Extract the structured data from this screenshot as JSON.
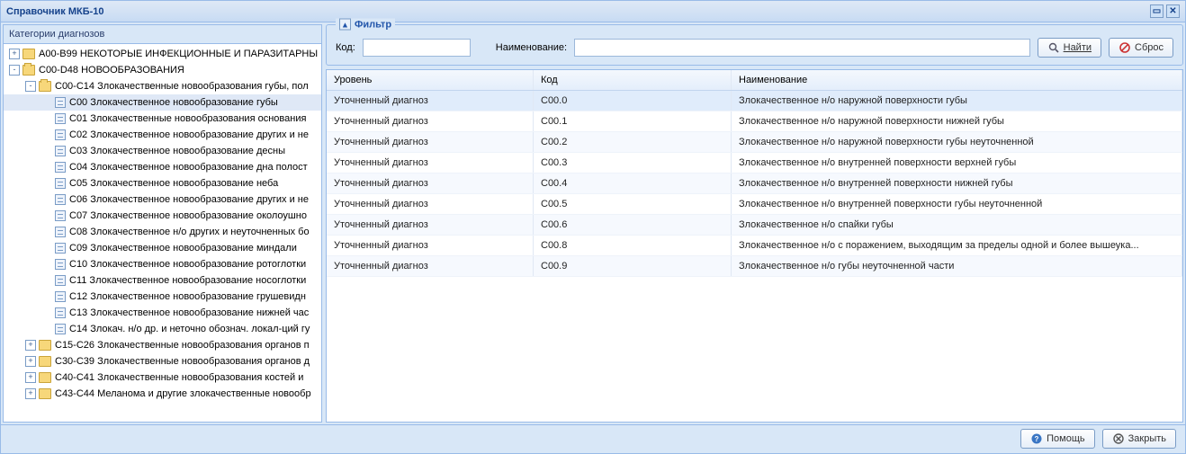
{
  "window": {
    "title": "Справочник МКБ-10"
  },
  "left_panel": {
    "title": "Категории диагнозов"
  },
  "tree": [
    {
      "indent": 0,
      "toggle": "+",
      "icon": "folder",
      "label": "A00-B99 НЕКОТОРЫЕ ИНФЕКЦИОННЫЕ И ПАРАЗИТАРНЫ",
      "name": "tree-a00-b99"
    },
    {
      "indent": 0,
      "toggle": "-",
      "icon": "folder-open",
      "label": "C00-D48 НОВООБРАЗОВАНИЯ",
      "name": "tree-c00-d48"
    },
    {
      "indent": 1,
      "toggle": "-",
      "icon": "folder-open",
      "label": "C00-C14 Злокачественные новообразования губы, пол",
      "name": "tree-c00-c14"
    },
    {
      "indent": 2,
      "toggle": "",
      "icon": "leaf",
      "label": "C00 Злокачественное новообразование губы",
      "selected": true,
      "name": "tree-c00"
    },
    {
      "indent": 2,
      "toggle": "",
      "icon": "leaf",
      "label": "C01 Злокачественные новообразования основания",
      "name": "tree-c01"
    },
    {
      "indent": 2,
      "toggle": "",
      "icon": "leaf",
      "label": "C02 Злокачественное новообразование других и не",
      "name": "tree-c02"
    },
    {
      "indent": 2,
      "toggle": "",
      "icon": "leaf",
      "label": "C03 Злокачественное новообразование десны",
      "name": "tree-c03"
    },
    {
      "indent": 2,
      "toggle": "",
      "icon": "leaf",
      "label": "C04 Злокачественное новообразование дна полост",
      "name": "tree-c04"
    },
    {
      "indent": 2,
      "toggle": "",
      "icon": "leaf",
      "label": "C05 Злокачественное новообразование неба",
      "name": "tree-c05"
    },
    {
      "indent": 2,
      "toggle": "",
      "icon": "leaf",
      "label": "C06 Злокачественное новообразование других и не",
      "name": "tree-c06"
    },
    {
      "indent": 2,
      "toggle": "",
      "icon": "leaf",
      "label": "C07 Злокачественное новообразование околоушно",
      "name": "tree-c07"
    },
    {
      "indent": 2,
      "toggle": "",
      "icon": "leaf",
      "label": "C08 Злокачественное н/о других и неуточненных бо",
      "name": "tree-c08"
    },
    {
      "indent": 2,
      "toggle": "",
      "icon": "leaf",
      "label": "C09 Злокачественное новообразование миндали",
      "name": "tree-c09"
    },
    {
      "indent": 2,
      "toggle": "",
      "icon": "leaf",
      "label": "C10 Злокачественное новообразование ротоглотки",
      "name": "tree-c10"
    },
    {
      "indent": 2,
      "toggle": "",
      "icon": "leaf",
      "label": "C11 Злокачественное новообразование носоглотки",
      "name": "tree-c11"
    },
    {
      "indent": 2,
      "toggle": "",
      "icon": "leaf",
      "label": "C12 Злокачественное новообразование грушевидн",
      "name": "tree-c12"
    },
    {
      "indent": 2,
      "toggle": "",
      "icon": "leaf",
      "label": "C13 Злокачественное новообразование нижней час",
      "name": "tree-c13"
    },
    {
      "indent": 2,
      "toggle": "",
      "icon": "leaf",
      "label": "C14 Злокач. н/о др. и неточно обознач. локал-ций гу",
      "name": "tree-c14"
    },
    {
      "indent": 1,
      "toggle": "+",
      "icon": "folder",
      "label": "C15-C26 Злокачественные новообразования органов п",
      "name": "tree-c15-c26"
    },
    {
      "indent": 1,
      "toggle": "+",
      "icon": "folder",
      "label": "C30-C39 Злокачественные новообразования органов д",
      "name": "tree-c30-c39"
    },
    {
      "indent": 1,
      "toggle": "+",
      "icon": "folder",
      "label": "C40-C41 Злокачественные новообразования костей и",
      "name": "tree-c40-c41"
    },
    {
      "indent": 1,
      "toggle": "+",
      "icon": "folder",
      "label": "C43-C44 Меланома и другие злокачественные новообр",
      "name": "tree-c43-c44"
    }
  ],
  "filter": {
    "title": "Фильтр",
    "code_label": "Код:",
    "name_label": "Наименование:",
    "find_label": "Найти",
    "reset_label": "Сброс"
  },
  "grid": {
    "headers": {
      "level": "Уровень",
      "code": "Код",
      "name": "Наименование"
    },
    "rows": [
      {
        "level": "Уточненный диагноз",
        "code": "C00.0",
        "name": "Злокачественное н/о наружной поверхности губы",
        "sel": true
      },
      {
        "level": "Уточненный диагноз",
        "code": "C00.1",
        "name": "Злокачественное н/о наружной поверхности нижней губы"
      },
      {
        "level": "Уточненный диагноз",
        "code": "C00.2",
        "name": "Злокачественное н/о наружной поверхности губы неуточненной"
      },
      {
        "level": "Уточненный диагноз",
        "code": "C00.3",
        "name": "Злокачественное н/о внутренней поверхности верхней губы"
      },
      {
        "level": "Уточненный диагноз",
        "code": "C00.4",
        "name": "Злокачественное н/о внутренней поверхности нижней губы"
      },
      {
        "level": "Уточненный диагноз",
        "code": "C00.5",
        "name": "Злокачественное н/о внутренней поверхности губы неуточненной"
      },
      {
        "level": "Уточненный диагноз",
        "code": "C00.6",
        "name": "Злокачественное н/о спайки губы"
      },
      {
        "level": "Уточненный диагноз",
        "code": "C00.8",
        "name": "Злокачественное н/о с поражением, выходящим за пределы одной и более вышеука..."
      },
      {
        "level": "Уточненный диагноз",
        "code": "C00.9",
        "name": "Злокачественное н/о губы неуточненной части"
      }
    ]
  },
  "footer": {
    "help_label": "Помощь",
    "close_label": "Закрыть"
  }
}
